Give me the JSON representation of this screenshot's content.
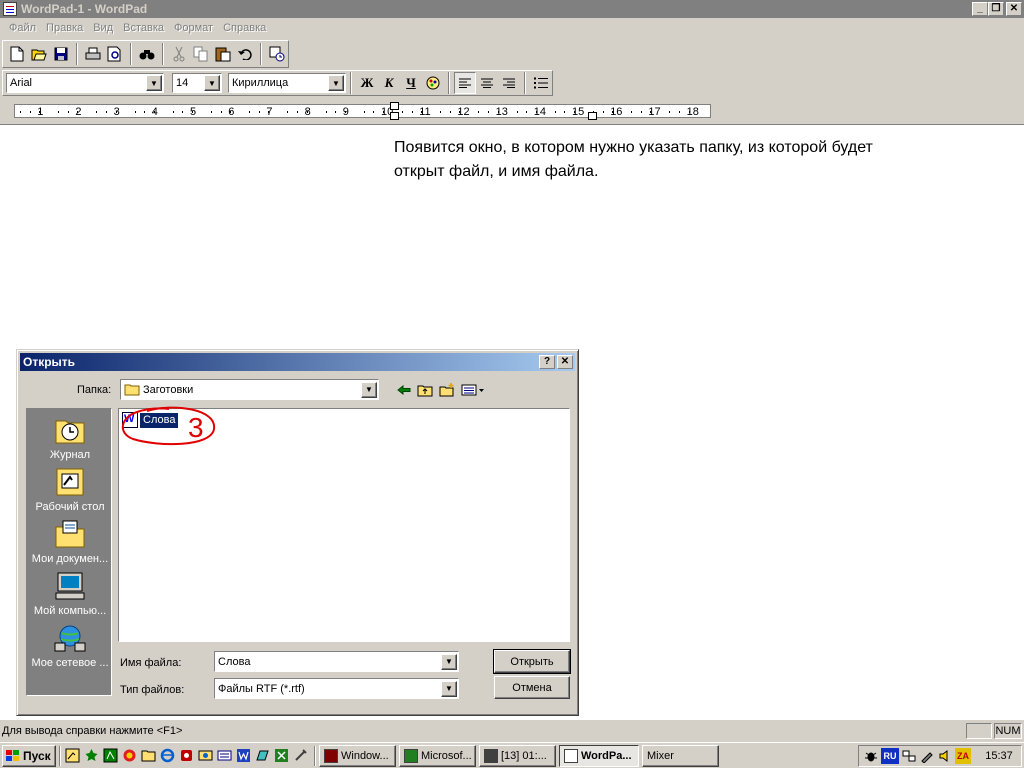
{
  "window": {
    "title": "WordPad-1 - WordPad",
    "controls": {
      "minimize": "_",
      "restore": "❐",
      "close": "✕"
    }
  },
  "menu": [
    "Файл",
    "Правка",
    "Вид",
    "Вставка",
    "Формат",
    "Справка"
  ],
  "toolbar": {
    "icons": [
      "new-document-icon",
      "open-folder-icon",
      "save-icon",
      "print-icon",
      "print-preview-icon",
      "find-icon",
      "cut-icon",
      "copy-icon",
      "paste-icon",
      "undo-icon",
      "insert-datetime-icon"
    ]
  },
  "format": {
    "font": "Arial",
    "size": "14",
    "script": "Кириллица",
    "bold": "Ж",
    "italic": "К",
    "underline": "Ч"
  },
  "ruler": {
    "labels": [
      "1",
      "2",
      "3",
      "4",
      "5",
      "6",
      "7",
      "8",
      "9",
      "10",
      "11",
      "12",
      "13",
      "14",
      "15",
      "16",
      "17",
      "18"
    ]
  },
  "document": {
    "line1": "Появится окно, в котором нужно указать папку, из которой будет",
    "line2": "открыт файл, и имя файла."
  },
  "dialog": {
    "title": "Открыть",
    "help": "?",
    "close": "✕",
    "folder_label": "Папка:",
    "folder_value": "Заготовки",
    "places": [
      {
        "label": "Журнал",
        "icon": "history-icon"
      },
      {
        "label": "Рабочий стол",
        "icon": "desktop-icon"
      },
      {
        "label": "Мои докумен...",
        "icon": "my-documents-icon"
      },
      {
        "label": "Мой компью...",
        "icon": "my-computer-icon"
      },
      {
        "label": "Мое сетевое ...",
        "icon": "network-places-icon"
      }
    ],
    "file": "Слова",
    "annotation": "3",
    "filename_label": "Имя файла:",
    "filename_value": "Слова",
    "filetype_label": "Тип файлов:",
    "filetype_value": "Файлы RTF (*.rtf)",
    "open_button": "Открыть",
    "cancel_button": "Отмена"
  },
  "status": {
    "text": "Для вывода справки нажмите <F1>",
    "num": "NUM"
  },
  "taskbar": {
    "start": "Пуск",
    "tasks": [
      "Window...",
      "Microsof...",
      "[13] 01:...",
      "WordPa...",
      "Mixer"
    ],
    "tray_lang": "RU",
    "tray_za": "ZA",
    "clock": "15:37"
  },
  "colors": {
    "face": "#d4d0c8",
    "dialog_title_start": "#0a246a",
    "dialog_title_end": "#a6caf0",
    "selection": "#0a246a",
    "annotation": "#e00000"
  }
}
